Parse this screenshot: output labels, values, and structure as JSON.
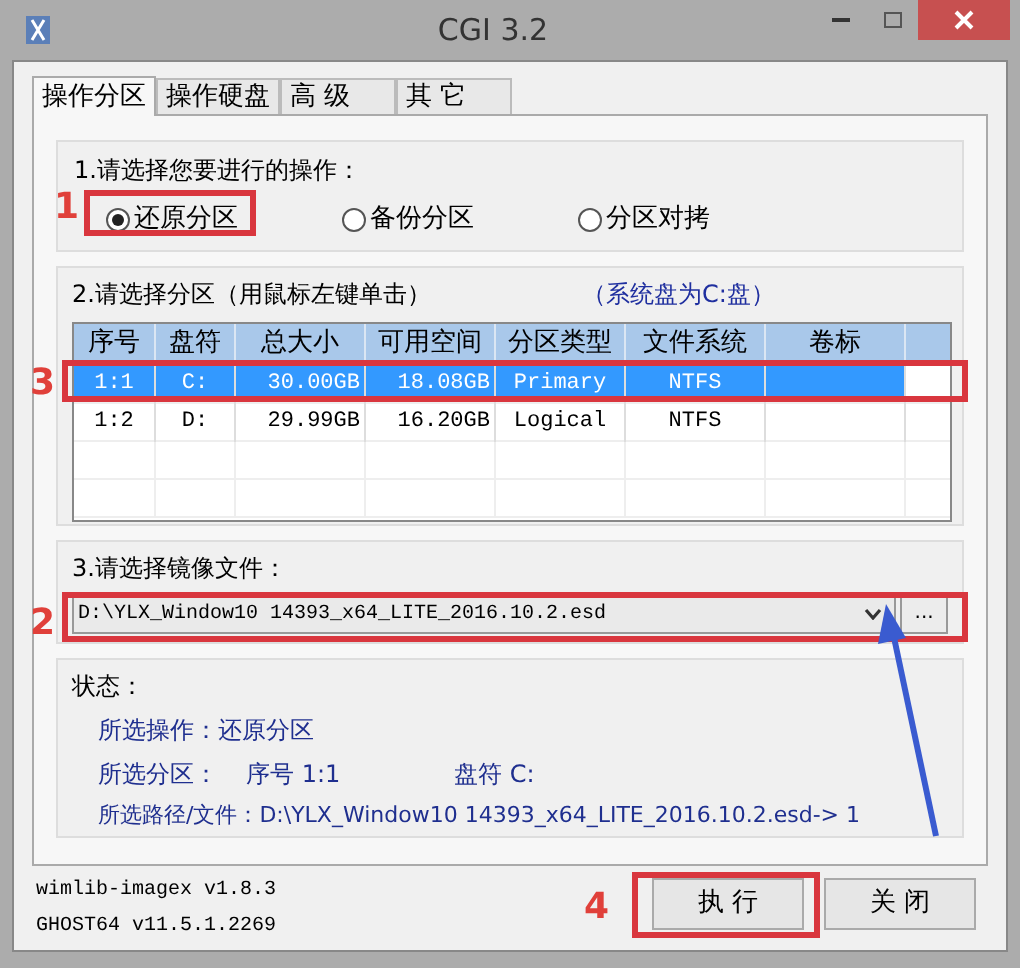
{
  "window": {
    "title": "CGI 3.2"
  },
  "tabs": [
    {
      "label": "操作分区",
      "selected": true
    },
    {
      "label": "操作硬盘",
      "selected": false
    },
    {
      "label": "高 级",
      "selected": false
    },
    {
      "label": "其 它",
      "selected": false
    }
  ],
  "operation": {
    "label": "1.请选择您要进行的操作：",
    "options": [
      {
        "label": "还原分区",
        "selected": true
      },
      {
        "label": "备份分区",
        "selected": false
      },
      {
        "label": "分区对拷",
        "selected": false
      }
    ]
  },
  "partition": {
    "label": "2.请选择分区（用鼠标左键单击）",
    "note": "（系统盘为C:盘）",
    "columns": [
      "序号",
      "盘符",
      "总大小",
      "可用空间",
      "分区类型",
      "文件系统",
      "卷标"
    ],
    "rows": [
      {
        "cells": [
          "1:1",
          "C:",
          "30.00GB",
          "18.08GB",
          "Primary",
          "NTFS",
          ""
        ],
        "selected": true
      },
      {
        "cells": [
          "1:2",
          "D:",
          "29.99GB",
          "16.20GB",
          "Logical",
          "NTFS",
          ""
        ],
        "selected": false
      }
    ]
  },
  "image": {
    "label": "3.请选择镜像文件：",
    "value": "D:\\YLX_Window10 14393_x64_LITE_2016.10.2.esd",
    "browse": "..."
  },
  "status": {
    "label": "状态：",
    "operation": "所选操作：还原分区",
    "partition_label": "所选分区：",
    "partition_number": "序号 1:1",
    "partition_drive": "盘符 C:",
    "path": "所选路径/文件：D:\\YLX_Window10 14393_x64_LITE_2016.10.2.esd->  1"
  },
  "versions": [
    "wimlib-imagex v1.8.3",
    "GHOST64 v11.5.1.2269"
  ],
  "buttons": [
    "执 行",
    "关 闭"
  ],
  "annotations": [
    "1",
    "3",
    "2",
    "4"
  ]
}
